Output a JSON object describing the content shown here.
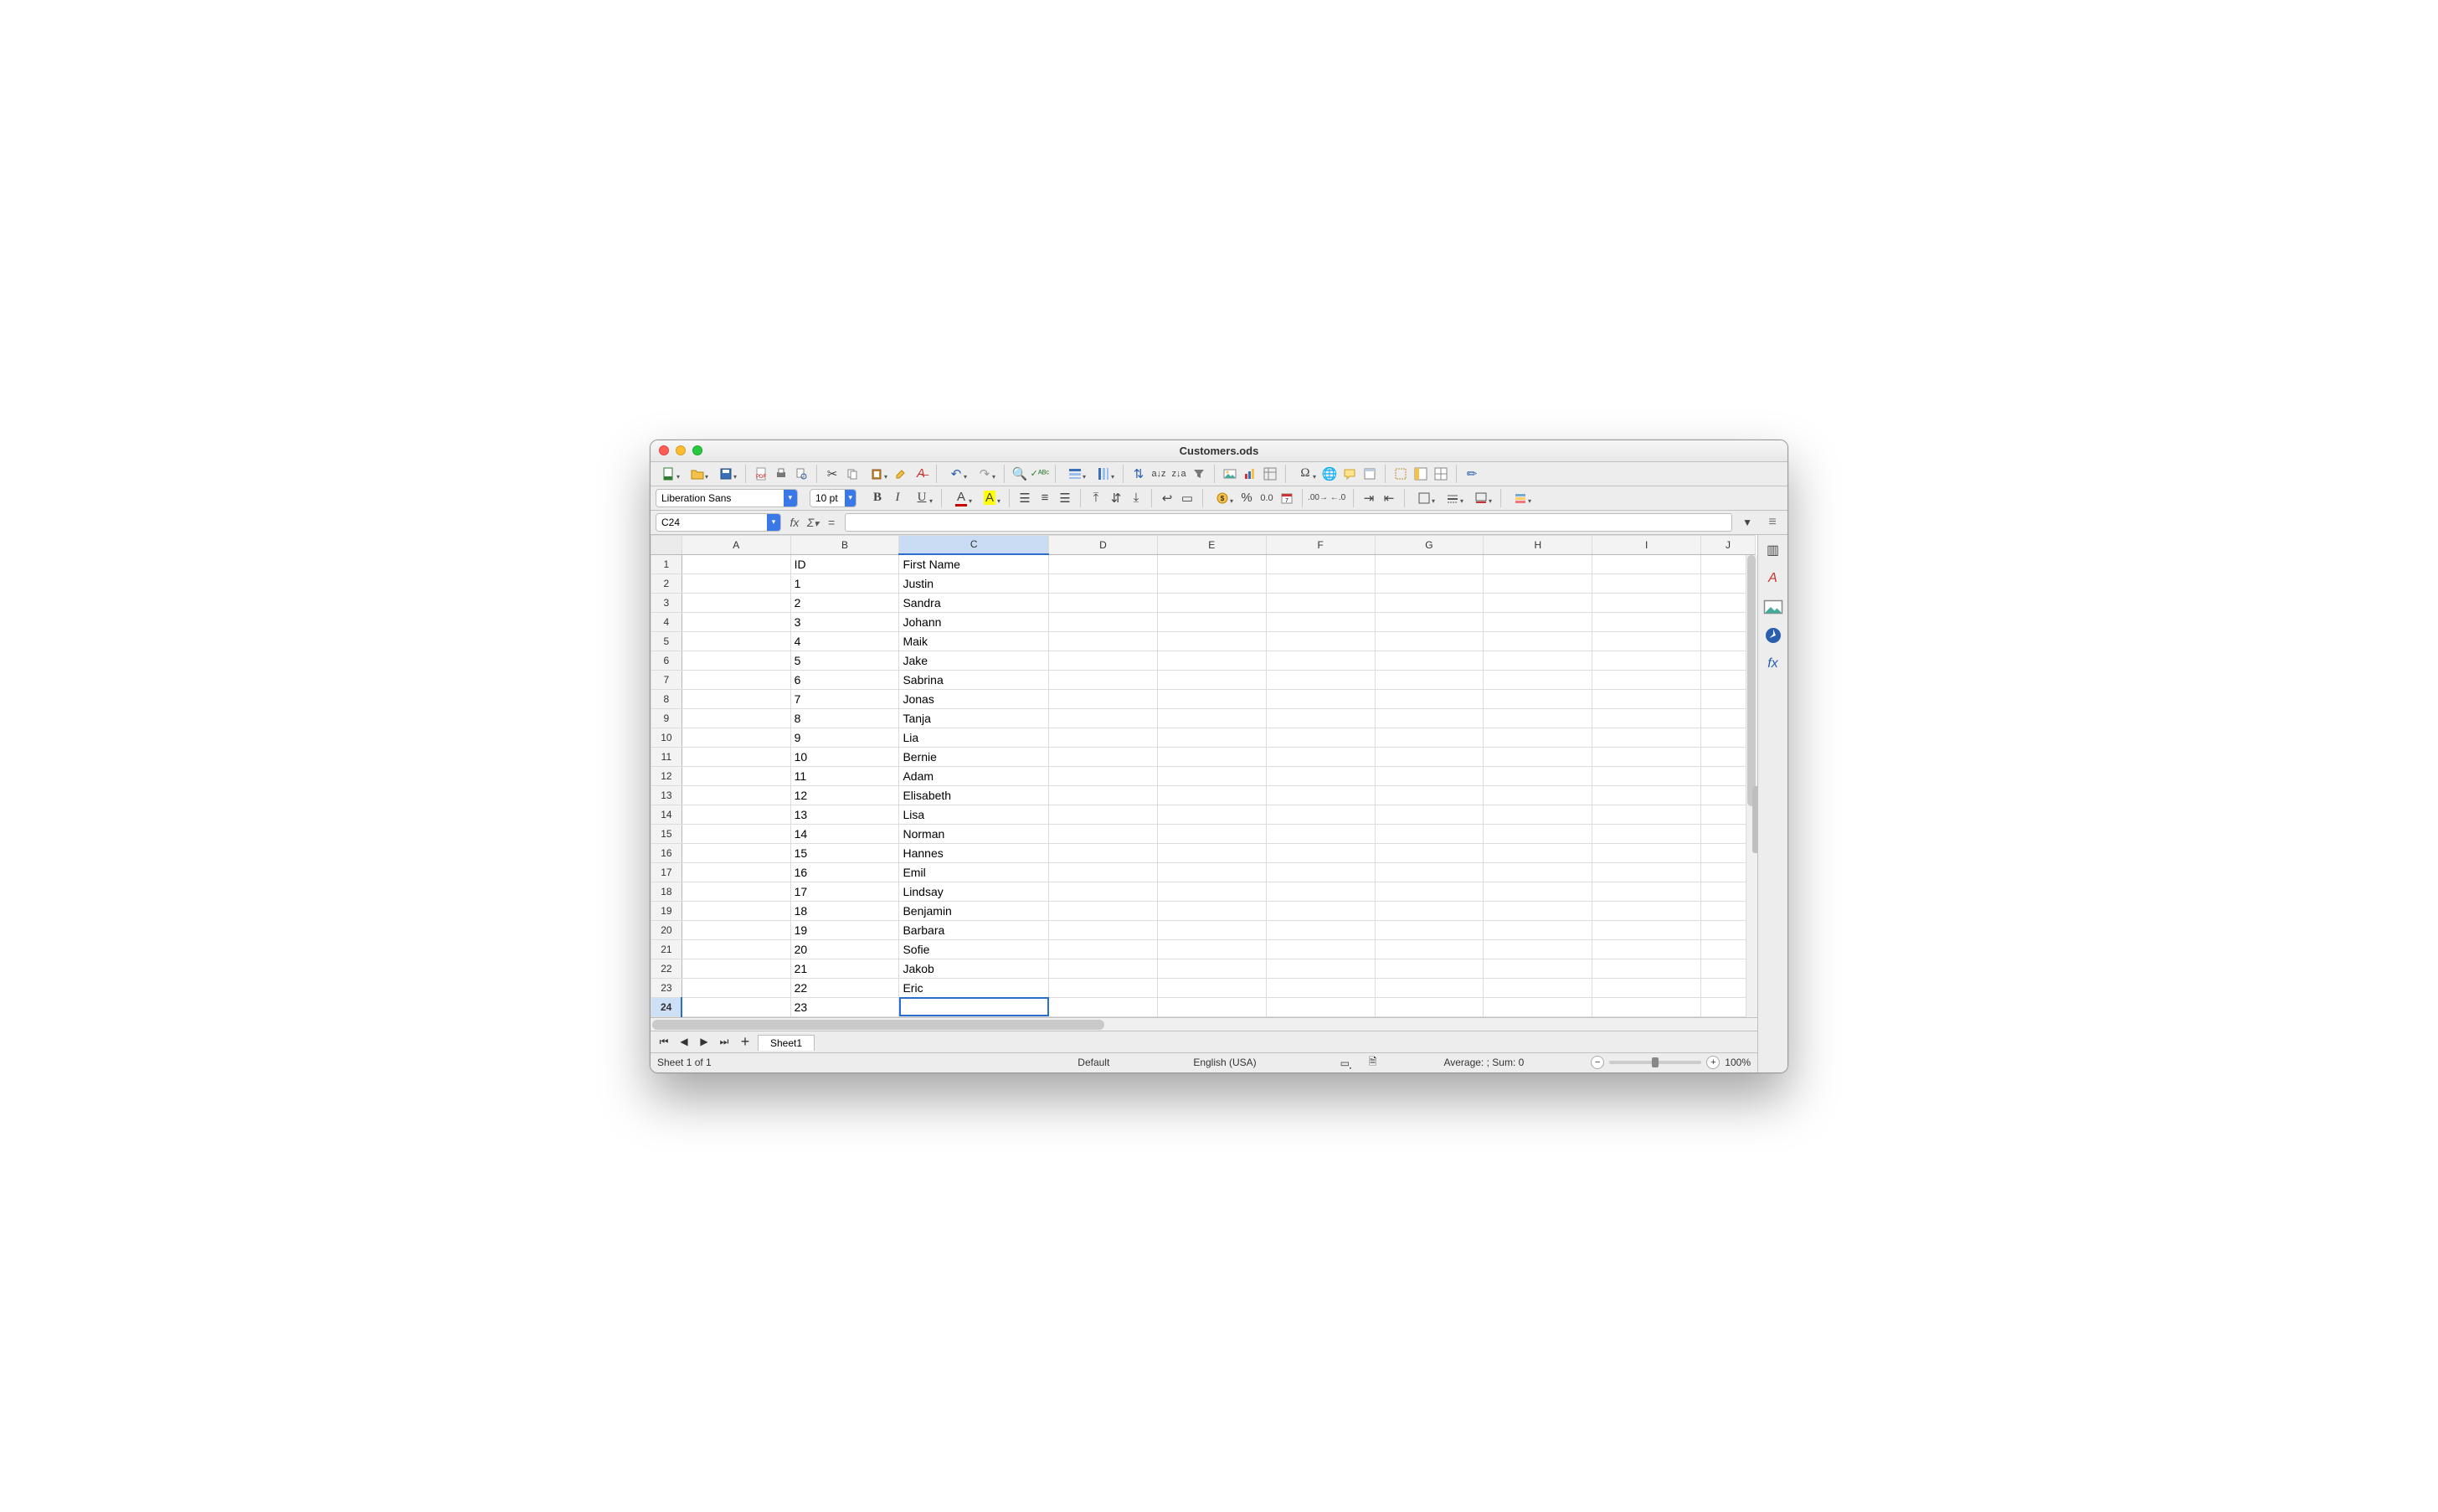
{
  "window": {
    "title": "Customers.ods"
  },
  "toolbar2": {
    "font_name": "Liberation Sans",
    "font_size": "10 pt"
  },
  "formula_bar": {
    "cell_ref": "C24",
    "formula": ""
  },
  "columns": [
    "A",
    "B",
    "C",
    "D",
    "E",
    "F",
    "G",
    "H",
    "I",
    "J"
  ],
  "selected_column_index": 2,
  "selected_row_index": 23,
  "rows": [
    {
      "n": 1,
      "A": "",
      "B": "ID",
      "C": "First Name"
    },
    {
      "n": 2,
      "A": "",
      "B": "1",
      "C": "Justin"
    },
    {
      "n": 3,
      "A": "",
      "B": "2",
      "C": "Sandra"
    },
    {
      "n": 4,
      "A": "",
      "B": "3",
      "C": "Johann"
    },
    {
      "n": 5,
      "A": "",
      "B": "4",
      "C": "Maik"
    },
    {
      "n": 6,
      "A": "",
      "B": "5",
      "C": "Jake"
    },
    {
      "n": 7,
      "A": "",
      "B": "6",
      "C": "Sabrina"
    },
    {
      "n": 8,
      "A": "",
      "B": "7",
      "C": "Jonas"
    },
    {
      "n": 9,
      "A": "",
      "B": "8",
      "C": "Tanja"
    },
    {
      "n": 10,
      "A": "",
      "B": "9",
      "C": "Lia"
    },
    {
      "n": 11,
      "A": "",
      "B": "10",
      "C": "Bernie"
    },
    {
      "n": 12,
      "A": "",
      "B": "11",
      "C": "Adam"
    },
    {
      "n": 13,
      "A": "",
      "B": "12",
      "C": "Elisabeth"
    },
    {
      "n": 14,
      "A": "",
      "B": "13",
      "C": "Lisa"
    },
    {
      "n": 15,
      "A": "",
      "B": "14",
      "C": "Norman"
    },
    {
      "n": 16,
      "A": "",
      "B": "15",
      "C": "Hannes"
    },
    {
      "n": 17,
      "A": "",
      "B": "16",
      "C": "Emil"
    },
    {
      "n": 18,
      "A": "",
      "B": "17",
      "C": "Lindsay"
    },
    {
      "n": 19,
      "A": "",
      "B": "18",
      "C": "Benjamin"
    },
    {
      "n": 20,
      "A": "",
      "B": "19",
      "C": "Barbara"
    },
    {
      "n": 21,
      "A": "",
      "B": "20",
      "C": "Sofie"
    },
    {
      "n": 22,
      "A": "",
      "B": "21",
      "C": "Jakob"
    },
    {
      "n": 23,
      "A": "",
      "B": "22",
      "C": "Eric"
    },
    {
      "n": 24,
      "A": "",
      "B": "23",
      "C": ""
    }
  ],
  "sheet_tabs": {
    "active": "Sheet1"
  },
  "statusbar": {
    "sheet_pos": "Sheet 1 of 1",
    "style": "Default",
    "language": "English (USA)",
    "aggregate": "Average: ; Sum: 0",
    "zoom": "100%"
  }
}
